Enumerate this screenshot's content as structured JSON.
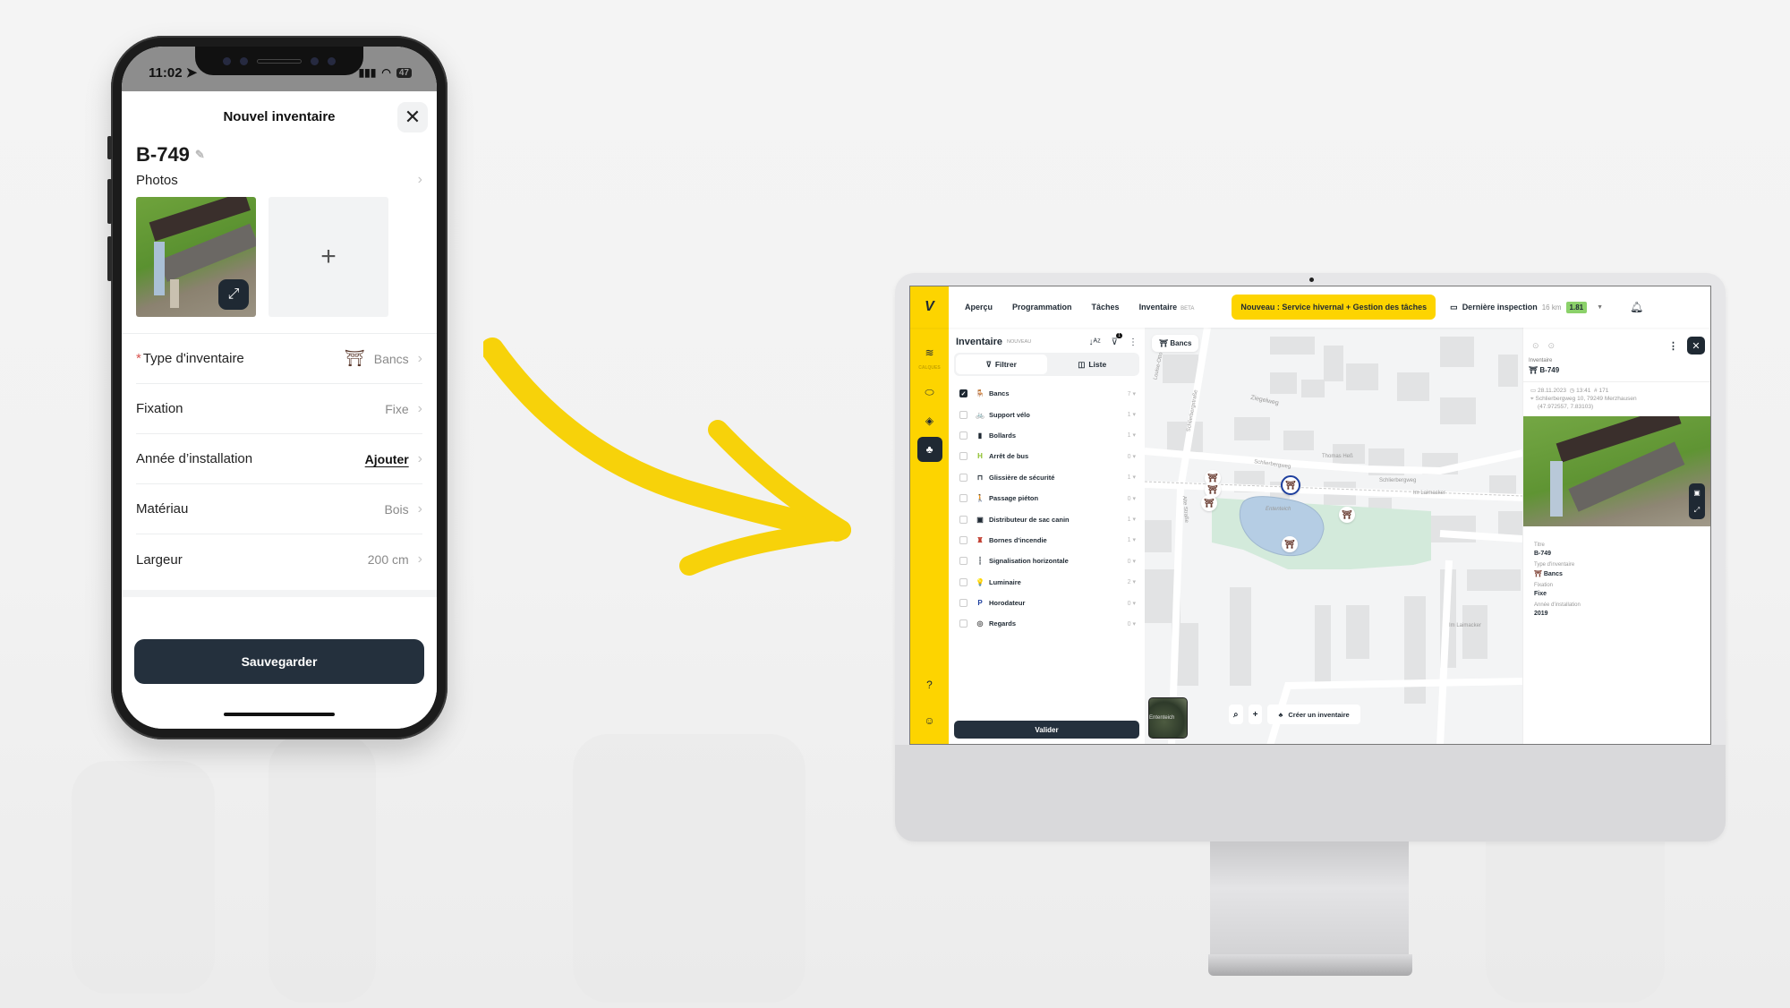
{
  "mobile": {
    "status_bar": {
      "time": "11:02",
      "battery": "47"
    },
    "sheet_title": "Nouvel inventaire",
    "close_glyph": "✕",
    "item_id": "B-749",
    "photos_label": "Photos",
    "add_photo_glyph": "+",
    "fields": [
      {
        "label": "Type d'inventaire",
        "required": true,
        "value": "Bancs",
        "icon": "bench-icon"
      },
      {
        "label": "Fixation",
        "value": "Fixe"
      },
      {
        "label": "Année d’installation",
        "value": "Ajouter",
        "is_action": true
      },
      {
        "label": "Matériau",
        "value": "Bois"
      },
      {
        "label": "Largeur",
        "value": "200 cm"
      }
    ],
    "save_label": "Sauvegarder"
  },
  "desktop": {
    "nav": {
      "logo": "V",
      "items": [
        "Aperçu",
        "Programmation",
        "Tâches",
        "Inventaire"
      ],
      "inventaire_badge": "BETA",
      "promo": "Nouveau : Service hivernal + Gestion des tâches",
      "inspection_label": "Dernière inspection",
      "inspection_distance": "16 km",
      "inspection_score": "1.81"
    },
    "sidebar": {
      "layers_label": "CALQUES"
    },
    "panel": {
      "title": "Inventaire",
      "title_badge": "NOUVEAU",
      "filter_count": "1",
      "tab_filter": "Filtrer",
      "tab_list": "Liste",
      "categories": [
        {
          "name": "Bancs",
          "count": "7",
          "checked": true,
          "icon": "🪑",
          "color": "#7a3b2e"
        },
        {
          "name": "Support vélo",
          "count": "1",
          "checked": false,
          "icon": "🚲",
          "color": "#1f2933"
        },
        {
          "name": "Bollards",
          "count": "1",
          "checked": false,
          "icon": "▮",
          "color": "#1f2933"
        },
        {
          "name": "Arrêt de bus",
          "count": "0",
          "checked": false,
          "icon": "H",
          "color": "#8cbf2a"
        },
        {
          "name": "Glissière de sécurité",
          "count": "1",
          "checked": false,
          "icon": "⊓",
          "color": "#1f2933"
        },
        {
          "name": "Passage piéton",
          "count": "0",
          "checked": false,
          "icon": "🚶",
          "color": "#1f2933"
        },
        {
          "name": "Distributeur de sac canin",
          "count": "1",
          "checked": false,
          "icon": "▣",
          "color": "#1f2933"
        },
        {
          "name": "Bornes d'incendie",
          "count": "1",
          "checked": false,
          "icon": "♜",
          "color": "#c0392b"
        },
        {
          "name": "Signalisation horizontale",
          "count": "0",
          "checked": false,
          "icon": "┆",
          "color": "#1f2933"
        },
        {
          "name": "Luminaire",
          "count": "2",
          "checked": false,
          "icon": "💡",
          "color": "#7ea61b"
        },
        {
          "name": "Horodateur",
          "count": "0",
          "checked": false,
          "icon": "P",
          "color": "#1e3f9e"
        },
        {
          "name": "Regards",
          "count": "0",
          "checked": false,
          "icon": "◎",
          "color": "#555"
        }
      ],
      "validate_label": "Valider"
    },
    "map": {
      "chip_label": "Bancs",
      "streets": [
        "Ziegelweg",
        "Schlierbergstraße",
        "Schlierbergweg",
        "Schlierbergweg",
        "Alte Straße",
        "Im Laimacker",
        "Im Laimacker",
        "Im Laimacker",
        "Louise-Otto"
      ],
      "pond_label": "Ententeich",
      "poi_label": "Thomas Heß",
      "minimap_label": "Ententeich",
      "create_label": "Créer un inventaire"
    },
    "detail": {
      "section_label": "Inventaire",
      "item_id": "B-749",
      "date": "28.11.2023",
      "time": "13:41",
      "number": "# 171",
      "address": "Schlierbergweg 10, 79249 Merzhausen",
      "coords": "(47.972557, 7.83103)",
      "fields": [
        {
          "label": "Titre",
          "value": "B-749"
        },
        {
          "label": "Type d'inventaire",
          "value": "Bancs"
        },
        {
          "label": "Fixation",
          "value": "Fixe"
        },
        {
          "label": "Année d'installation",
          "value": "2019"
        }
      ]
    }
  },
  "colors": {
    "brand_yellow": "#fdd400",
    "dark": "#24303d",
    "score_green": "#8bd16a",
    "selected_pin": "#1e3f9e"
  }
}
